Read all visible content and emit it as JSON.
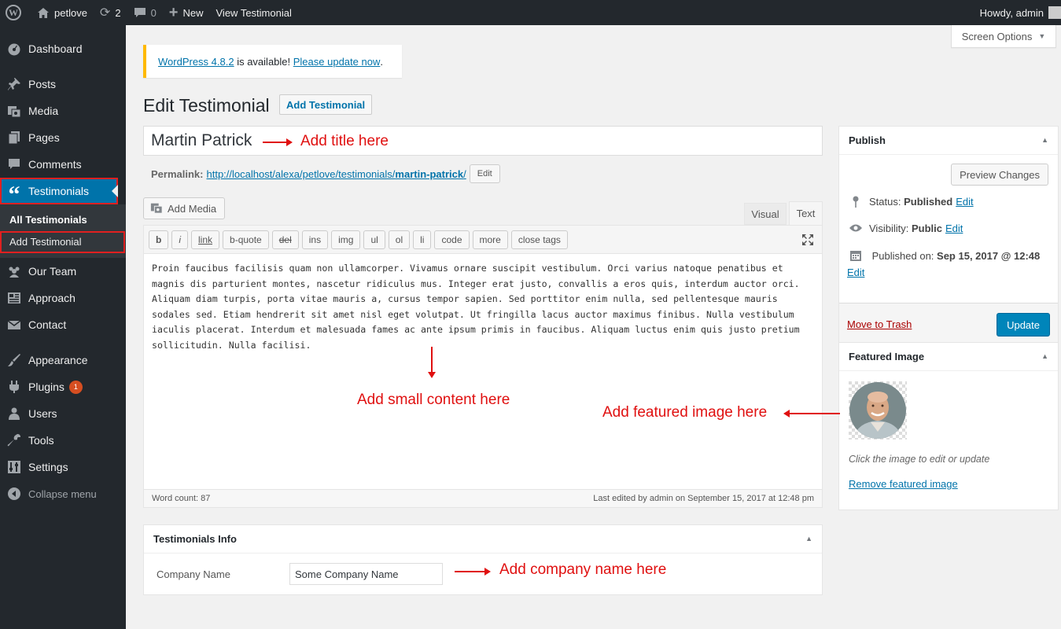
{
  "adminbar": {
    "site_name": "petlove",
    "updates_count": "2",
    "comments_count": "0",
    "new_label": "New",
    "view_label": "View Testimonial",
    "greeting": "Howdy, admin"
  },
  "sidebar": {
    "items": [
      {
        "label": "Dashboard",
        "icon": "dashboard-icon"
      },
      {
        "label": "Posts",
        "icon": "pin-icon"
      },
      {
        "label": "Media",
        "icon": "media-icon"
      },
      {
        "label": "Pages",
        "icon": "pages-icon"
      },
      {
        "label": "Comments",
        "icon": "comment-icon"
      },
      {
        "label": "Testimonials",
        "icon": "quote-icon"
      },
      {
        "label": "Our Team",
        "icon": "team-icon"
      },
      {
        "label": "Approach",
        "icon": "approach-icon"
      },
      {
        "label": "Contact",
        "icon": "mail-icon"
      },
      {
        "label": "Appearance",
        "icon": "brush-icon"
      },
      {
        "label": "Plugins",
        "icon": "plugin-icon",
        "badge": "1"
      },
      {
        "label": "Users",
        "icon": "user-icon"
      },
      {
        "label": "Tools",
        "icon": "wrench-icon"
      },
      {
        "label": "Settings",
        "icon": "settings-icon"
      },
      {
        "label": "Collapse menu",
        "icon": "collapse-icon"
      }
    ],
    "submenu": [
      "All Testimonials",
      "Add Testimonial"
    ]
  },
  "screen_options": "Screen Options",
  "notice": {
    "version_link": "WordPress 4.8.2",
    "middle": " is available! ",
    "update_link": "Please update now",
    "end": "."
  },
  "page": {
    "title": "Edit Testimonial",
    "add_new": "Add Testimonial"
  },
  "post": {
    "title": "Martin Patrick",
    "permalink_label": "Permalink:",
    "permalink_base": "http://localhost/alexa/petlove/testimonials/",
    "permalink_slug": "martin-patrick",
    "permalink_end": "/",
    "edit_label": "Edit"
  },
  "editor": {
    "add_media": "Add Media",
    "tab_visual": "Visual",
    "tab_text": "Text",
    "quicktags": [
      "b",
      "i",
      "link",
      "b-quote",
      "del",
      "ins",
      "img",
      "ul",
      "ol",
      "li",
      "code",
      "more",
      "close tags"
    ],
    "content": "Proin faucibus facilisis quam non ullamcorper. Vivamus ornare suscipit vestibulum. Orci varius natoque penatibus et magnis dis parturient montes, nascetur ridiculus mus. Integer erat justo, convallis a eros quis, interdum auctor orci. Aliquam diam turpis, porta vitae mauris a, cursus tempor sapien. Sed porttitor enim nulla, sed pellentesque mauris sodales sed. Etiam hendrerit sit amet nisl eget volutpat. Ut fringilla lacus auctor maximus finibus. Nulla vestibulum iaculis placerat. Interdum et malesuada fames ac ante ipsum primis in faucibus. Aliquam luctus enim quis justo pretium sollicitudin. Nulla facilisi.",
    "word_count": "Word count: 87",
    "last_edited": "Last edited by admin on September 15, 2017 at 12:48 pm"
  },
  "testimonials_info": {
    "heading": "Testimonials Info",
    "company_label": "Company Name",
    "company_value": "Some Company Name"
  },
  "publish": {
    "heading": "Publish",
    "preview": "Preview Changes",
    "status_label": "Status: ",
    "status_value": "Published",
    "visibility_label": "Visibility: ",
    "visibility_value": "Public",
    "published_label": "Published on: ",
    "published_value": "Sep 15, 2017 @ 12:48",
    "edit": "Edit",
    "trash": "Move to Trash",
    "update": "Update"
  },
  "featured": {
    "heading": "Featured Image",
    "hint": "Click the image to edit or update",
    "remove": "Remove featured image"
  },
  "annotations": {
    "title": "Add title here",
    "content": "Add small content here",
    "featured": "Add featured image here",
    "company": "Add company name here"
  },
  "colors": {
    "adminbar": "#23282d",
    "accent": "#0073aa",
    "update_button": "#0085ba",
    "annotation": "#e01010",
    "notice_border": "#ffb900"
  }
}
